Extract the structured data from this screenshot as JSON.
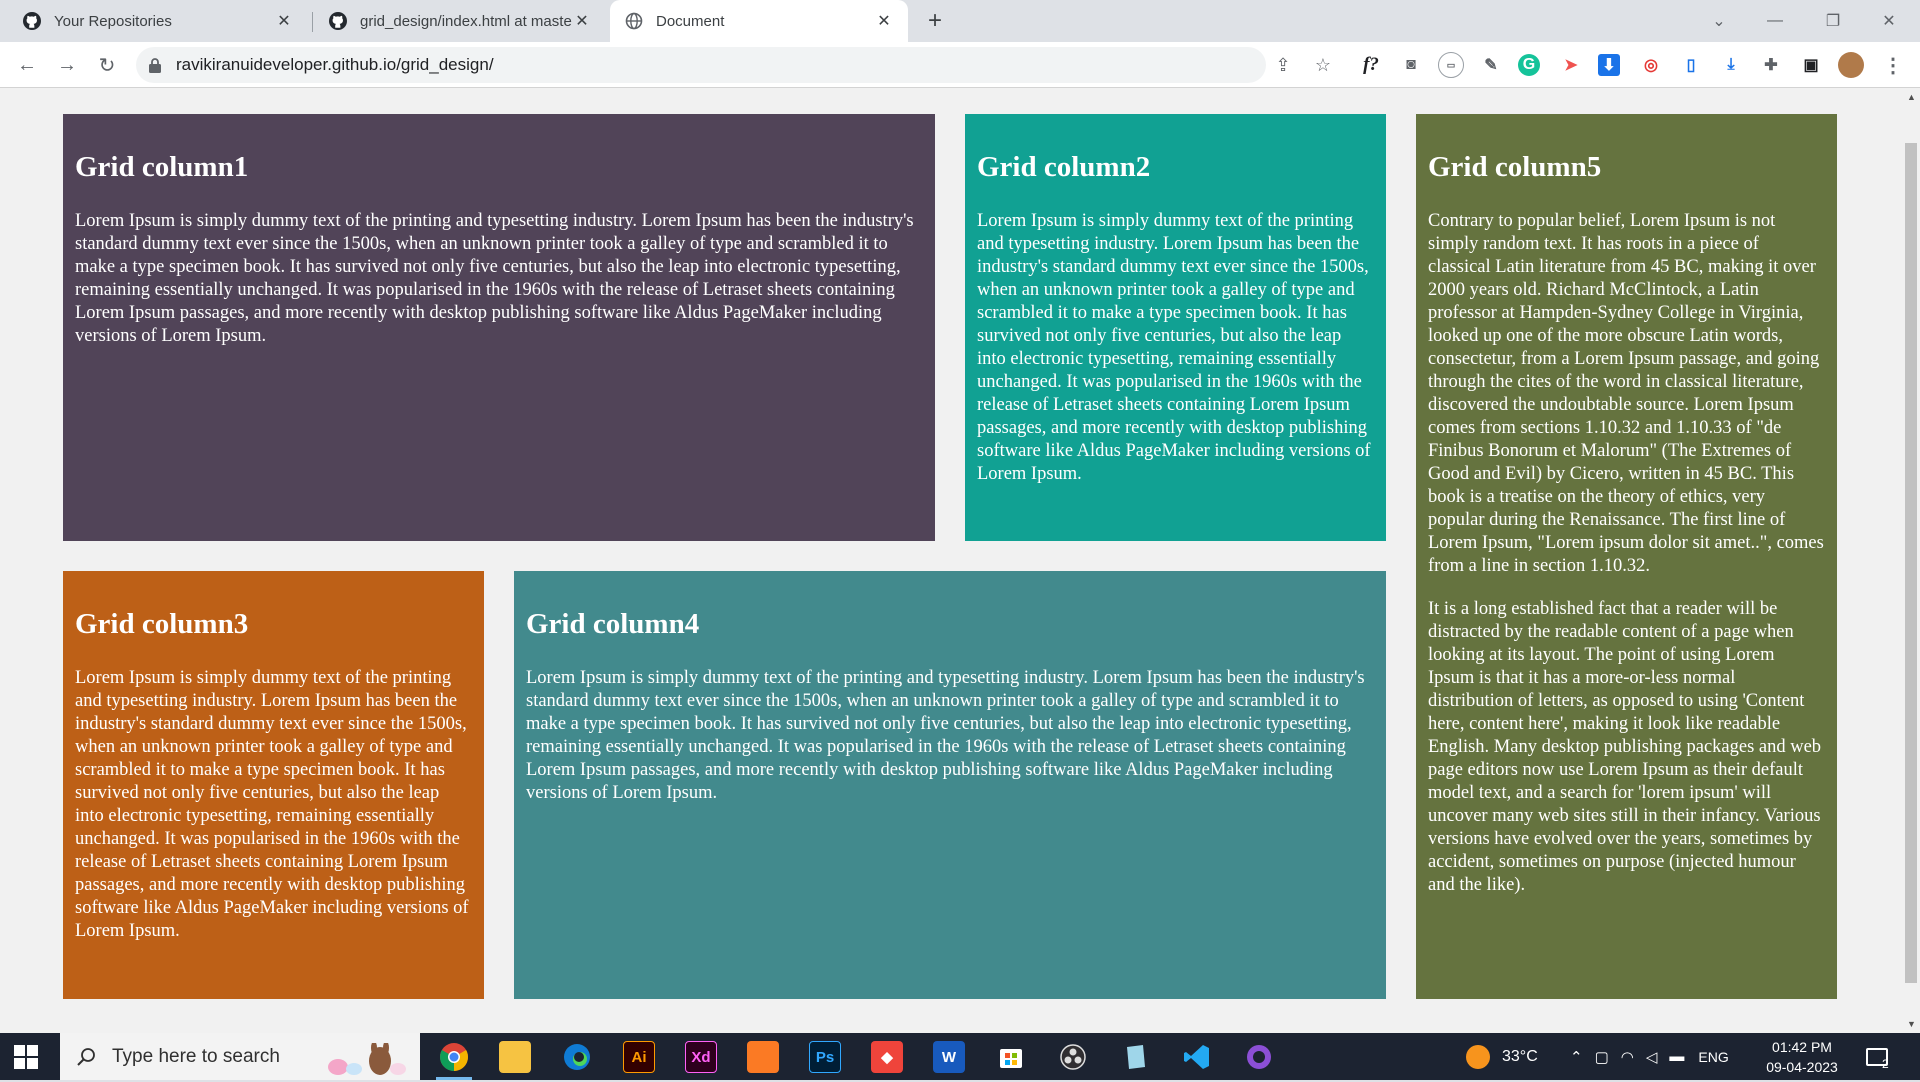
{
  "browser": {
    "tabs": [
      {
        "title": "Your Repositories",
        "active": false
      },
      {
        "title": "grid_design/index.html at master",
        "active": false
      },
      {
        "title": "Document",
        "active": true
      }
    ],
    "url": "ravikiranuideveloper.github.io/grid_design/",
    "ext_fx": "f?"
  },
  "page": {
    "columns": {
      "c1": {
        "heading": "Grid column1",
        "paragraphs": [
          "Lorem Ipsum is simply dummy text of the printing and typesetting industry. Lorem Ipsum has been the industry's standard dummy text ever since the 1500s, when an unknown printer took a galley of type and scrambled it to make a type specimen book. It has survived not only five centuries, but also the leap into electronic typesetting, remaining essentially unchanged. It was popularised in the 1960s with the release of Letraset sheets containing Lorem Ipsum passages, and more recently with desktop publishing software like Aldus PageMaker including versions of Lorem Ipsum."
        ]
      },
      "c2": {
        "heading": "Grid column2",
        "paragraphs": [
          "Lorem Ipsum is simply dummy text of the printing and typesetting industry. Lorem Ipsum has been the industry's standard dummy text ever since the 1500s, when an unknown printer took a galley of type and scrambled it to make a type specimen book. It has survived not only five centuries, but also the leap into electronic typesetting, remaining essentially unchanged. It was popularised in the 1960s with the release of Letraset sheets containing Lorem Ipsum passages, and more recently with desktop publishing software like Aldus PageMaker including versions of Lorem Ipsum."
        ]
      },
      "c3": {
        "heading": "Grid column3",
        "paragraphs": [
          "Lorem Ipsum is simply dummy text of the printing and typesetting industry. Lorem Ipsum has been the industry's standard dummy text ever since the 1500s, when an unknown printer took a galley of type and scrambled it to make a type specimen book. It has survived not only five centuries, but also the leap into electronic typesetting, remaining essentially unchanged. It was popularised in the 1960s with the release of Letraset sheets containing Lorem Ipsum passages, and more recently with desktop publishing software like Aldus PageMaker including versions of Lorem Ipsum."
        ]
      },
      "c4": {
        "heading": "Grid column4",
        "paragraphs": [
          "Lorem Ipsum is simply dummy text of the printing and typesetting industry. Lorem Ipsum has been the industry's standard dummy text ever since the 1500s, when an unknown printer took a galley of type and scrambled it to make a type specimen book. It has survived not only five centuries, but also the leap into electronic typesetting, remaining essentially unchanged. It was popularised in the 1960s with the release of Letraset sheets containing Lorem Ipsum passages, and more recently with desktop publishing software like Aldus PageMaker including versions of Lorem Ipsum."
        ]
      },
      "c5": {
        "heading": "Grid column5",
        "paragraphs": [
          "Contrary to popular belief, Lorem Ipsum is not simply random text. It has roots in a piece of classical Latin literature from 45 BC, making it over 2000 years old. Richard McClintock, a Latin professor at Hampden-Sydney College in Virginia, looked up one of the more obscure Latin words, consectetur, from a Lorem Ipsum passage, and going through the cites of the word in classical literature, discovered the undoubtable source. Lorem Ipsum comes from sections 1.10.32 and 1.10.33 of \"de Finibus Bonorum et Malorum\" (The Extremes of Good and Evil) by Cicero, written in 45 BC. This book is a treatise on the theory of ethics, very popular during the Renaissance. The first line of Lorem Ipsum, \"Lorem ipsum dolor sit amet..\", comes from a line in section 1.10.32.",
          "It is a long established fact that a reader will be distracted by the readable content of a page when looking at its layout. The point of using Lorem Ipsum is that it has a more-or-less normal distribution of letters, as opposed to using 'Content here, content here', making it look like readable English. Many desktop publishing packages and web page editors now use Lorem Ipsum as their default model text, and a search for 'lorem ipsum' will uncover many web sites still in their infancy. Various versions have evolved over the years, sometimes by accident, sometimes on purpose (injected humour and the like)."
        ]
      }
    },
    "colors": {
      "c1": "#514458",
      "c2": "#11a193",
      "c3": "#bd6017",
      "c4": "#428a8d",
      "c5": "#65733f"
    }
  },
  "taskbar": {
    "search_placeholder": "Type here to search",
    "apps": [
      {
        "label": "",
        "icon": "chrome-icon"
      },
      {
        "label": "",
        "icon": "file-explorer-icon"
      },
      {
        "label": "",
        "icon": "edge-icon"
      },
      {
        "label": "Ai",
        "icon": "illustrator-icon"
      },
      {
        "label": "Xd",
        "icon": "xd-icon"
      },
      {
        "label": "",
        "icon": "xampp-icon"
      },
      {
        "label": "Ps",
        "icon": "photoshop-icon"
      },
      {
        "label": "",
        "icon": "anydesk-icon"
      },
      {
        "label": "W",
        "icon": "word-icon"
      },
      {
        "label": "",
        "icon": "store-icon"
      },
      {
        "label": "",
        "icon": "obs-icon"
      },
      {
        "label": "",
        "icon": "notepad-icon"
      },
      {
        "label": "",
        "icon": "vscode-icon"
      },
      {
        "label": "",
        "icon": "github-desktop-icon"
      }
    ],
    "weather": "33°C",
    "language": "ENG",
    "time": "01:42 PM",
    "date": "09-04-2023",
    "notification_count": "2"
  }
}
